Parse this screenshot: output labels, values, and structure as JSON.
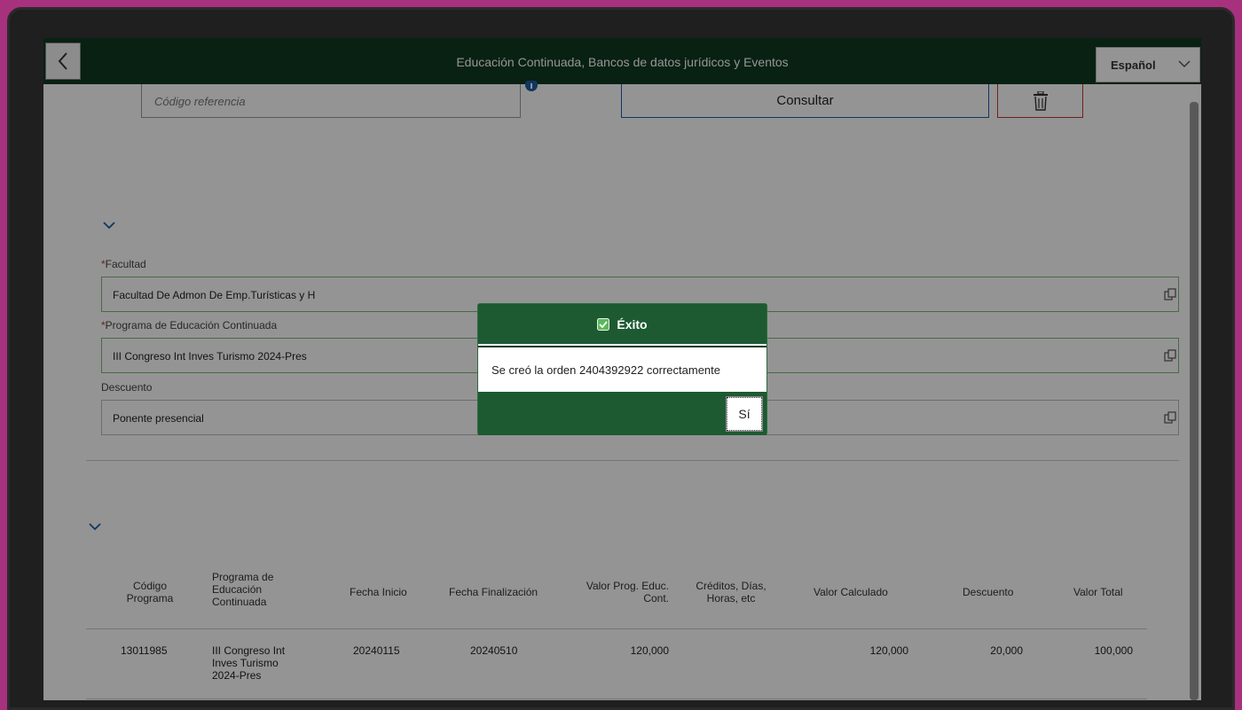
{
  "header": {
    "title": "Educación Continuada, Bancos de datos jurídicos y Eventos",
    "language": "Español"
  },
  "search": {
    "ref_placeholder": "Código referencia",
    "consult_label": "Consultar"
  },
  "form": {
    "required_mark": "*",
    "faculty_label": "Facultad",
    "faculty_value": "Facultad De Admon De Emp.Turísticas  y H",
    "program_label": "Programa de Educación Continuada",
    "program_value": "III Congreso Int Inves Turismo 2024-Pres",
    "discount_label": "Descuento",
    "discount_value": "Ponente presencial"
  },
  "table": {
    "headers": [
      "Código Programa",
      "Programa de Educación Continuada",
      "Fecha Inicio",
      "Fecha Finalización",
      "Valor Prog. Educ. Cont.",
      "Créditos, Días, Horas, etc",
      "Valor Calculado",
      "Descuento",
      "Valor Total"
    ],
    "rows": [
      [
        "13011985",
        "III Congreso Int Inves Turismo 2024-Pres",
        "20240115",
        "20240510",
        "120,000",
        "",
        "120,000",
        "20,000",
        "100,000"
      ]
    ]
  },
  "dialog": {
    "title": "Éxito",
    "message": "Se creó la orden 2404392922 correctamente",
    "yes_label": "Sí"
  },
  "colors": {
    "header_bg": "#0e3a22",
    "dialog_header": "#1d5a32",
    "background": "#a8317e",
    "required": "#c0392b",
    "consult_border": "#1e5ea8"
  },
  "icons": [
    "back-arrow-icon",
    "chevron-down-icon",
    "info-icon",
    "trash-icon",
    "copy-icon",
    "check-icon"
  ]
}
